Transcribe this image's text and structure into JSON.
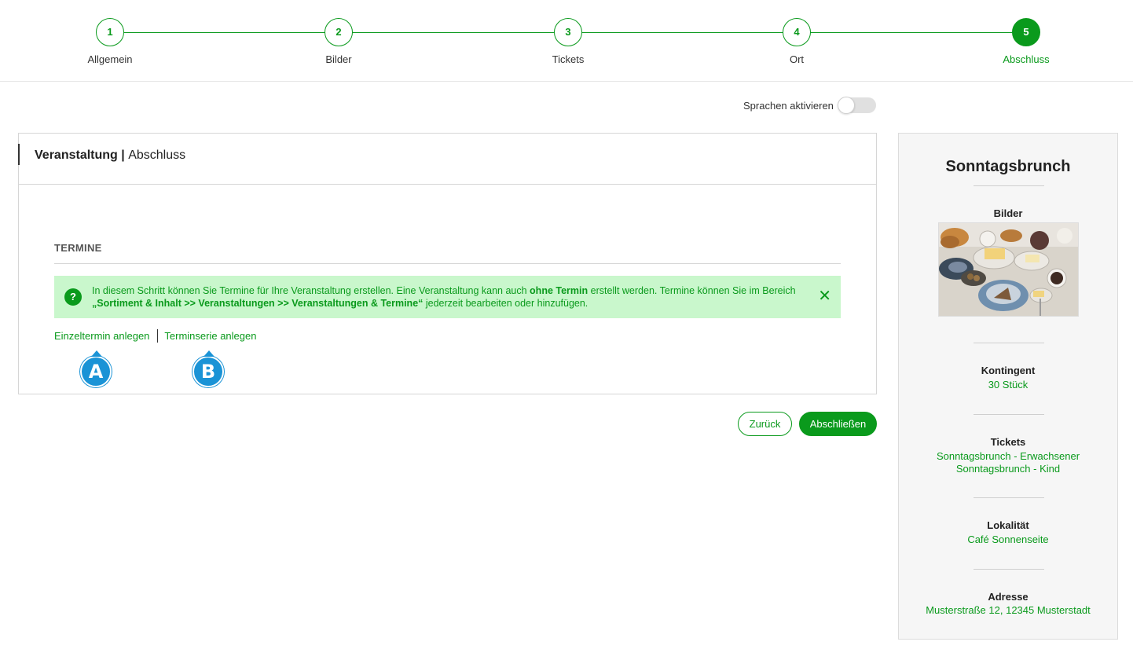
{
  "stepper": {
    "steps": [
      {
        "number": "1",
        "label": "Allgemein"
      },
      {
        "number": "2",
        "label": "Bilder"
      },
      {
        "number": "3",
        "label": "Tickets"
      },
      {
        "number": "4",
        "label": "Ort"
      },
      {
        "number": "5",
        "label": "Abschluss"
      }
    ],
    "active_step": 5
  },
  "language_toggle": {
    "label": "Sprachen aktivieren",
    "enabled": false
  },
  "panel": {
    "title_bold": "Veranstaltung",
    "title_sep": " | ",
    "title_rest": "Abschluss",
    "section_title": "TERMINE",
    "info": {
      "icon": "?",
      "text_1": "In diesem Schritt können Sie Termine für Ihre Veranstaltung erstellen. Eine Veranstaltung kann auch ",
      "text_bold_1": "ohne Termin",
      "text_2": " erstellt werden. Termine können Sie im Bereich ",
      "text_bold_2": "„Sortiment & Inhalt >> Veranstaltungen >> Veranstaltungen & Termine“",
      "text_3": " jederzeit bearbeiten oder hinzufügen.",
      "close": "✕"
    },
    "links": {
      "single": "Einzeltermin anlegen",
      "series": "Terminserie anlegen"
    },
    "markers": {
      "a": "A",
      "b": "B"
    }
  },
  "buttons": {
    "back": "Zurück",
    "finish": "Abschließen"
  },
  "summary": {
    "title": "Sonntagsbrunch",
    "images_label": "Bilder",
    "quota_label": "Kontingent",
    "quota_value": "30 Stück",
    "tickets_label": "Tickets",
    "tickets": [
      "Sonntagsbrunch - Erwachsener",
      "Sonntagsbrunch - Kind"
    ],
    "location_label": "Lokalität",
    "location_value": "Café Sonnenseite",
    "address_label": "Adresse",
    "address_value": "Musterstraße 12, 12345 Musterstadt"
  },
  "colors": {
    "accent": "#0a9a1c",
    "info_bg": "#c9f7cc",
    "marker": "#1a93d6"
  }
}
